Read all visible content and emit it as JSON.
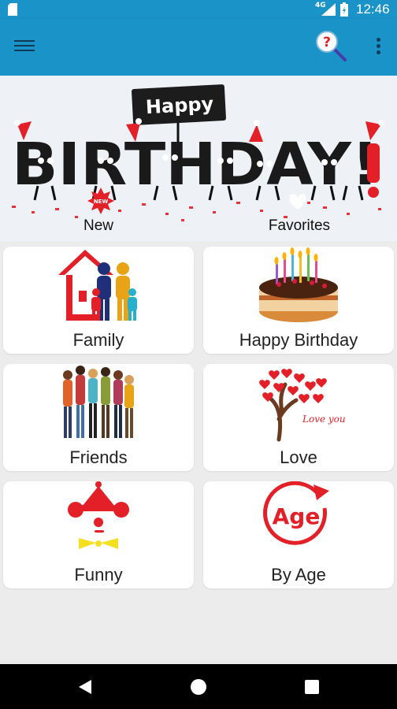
{
  "status_bar": {
    "network": "4G",
    "time": "12:46"
  },
  "app_bar": {
    "menu_icon": "hamburger-menu-icon",
    "help_icon": "help-search-icon",
    "more_icon": "more-vert-icon"
  },
  "banner": {
    "happy_text": "Happy",
    "birthday_text": "BIRTHDAY!",
    "new_badge": "NEW",
    "new_label": "New",
    "favorites_label": "Favorites"
  },
  "categories": [
    {
      "label": "Family",
      "icon": "family-house-icon"
    },
    {
      "label": "Happy Birthday",
      "icon": "birthday-cake-icon"
    },
    {
      "label": "Friends",
      "icon": "friends-group-icon"
    },
    {
      "label": "Love",
      "icon": "love-heart-tree-icon",
      "art_text": "Love you"
    },
    {
      "label": "Funny",
      "icon": "clown-face-icon"
    },
    {
      "label": "By Age",
      "icon": "age-cycle-icon",
      "art_text": "Age"
    }
  ],
  "colors": {
    "primary": "#1a93c9",
    "primary_dark": "#0d3b57",
    "accent_red": "#e32027"
  }
}
